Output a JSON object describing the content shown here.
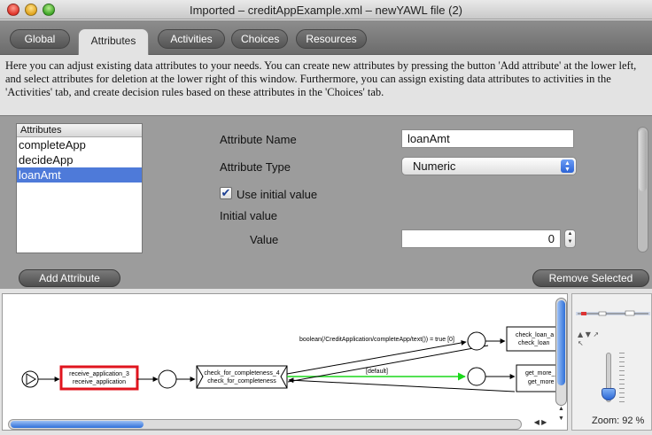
{
  "window": {
    "title": "Imported – creditAppExample.xml – newYAWL file (2)"
  },
  "tabs": [
    {
      "label": "Global"
    },
    {
      "label": "Attributes"
    },
    {
      "label": "Activities"
    },
    {
      "label": "Choices"
    },
    {
      "label": "Resources"
    }
  ],
  "active_tab": "Attributes",
  "description": "Here you can adjust existing data attributes to your needs. You can create new attributes by pressing the button 'Add attribute' at the lower left, and select attributes for deletion at the lower right of this window.  Furthermore, you can assign existing data attributes to activities in the 'Activities' tab, and create decision rules based on these attributes in the 'Choices' tab.",
  "attribute_list": {
    "header": "Attributes",
    "items": [
      "completeApp",
      "decideApp",
      "loanAmt"
    ],
    "selected": "loanAmt"
  },
  "form": {
    "name_label": "Attribute Name",
    "name_value": "loanAmt",
    "type_label": "Attribute Type",
    "type_value": "Numeric",
    "use_initial_label": "Use initial value",
    "use_initial_checked": true,
    "initial_value_label": "Initial value",
    "value_label": "Value",
    "value": "0"
  },
  "buttons": {
    "add": "Add Attribute",
    "remove": "Remove Selected"
  },
  "diagram": {
    "tasks": {
      "receive_line1": "receive_application_3",
      "receive_line2": "receive_application",
      "completeness_line1": "check_for_completeness_4",
      "completeness_line2": "check_for_completeness",
      "check_loan_line1": "check_loan_a",
      "check_loan_line2": "check_loan",
      "get_more_line1": "get_more_",
      "get_more_line2": "get_more"
    },
    "edge_labels": {
      "condition": "boolean(/CreditApplication/completeApp/text()) = true [0]",
      "default": "[default]"
    }
  },
  "zoom": {
    "label": "Zoom: 92 %",
    "percent": 92
  },
  "colors": {
    "selection": "#4e7ad9",
    "selected_task_border": "#e0141e",
    "default_edge": "#1ad81a"
  }
}
